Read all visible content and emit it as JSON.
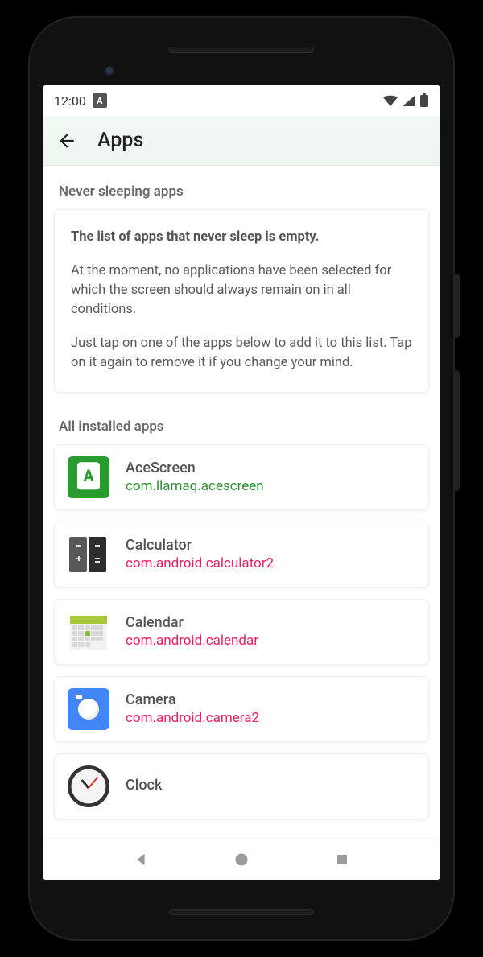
{
  "status": {
    "time": "12:00"
  },
  "header": {
    "title": "Apps"
  },
  "sections": {
    "never_sleeping_label": "Never sleeping apps",
    "all_installed_label": "All installed apps"
  },
  "info": {
    "title": "The list of apps that never sleep is empty.",
    "line1": "At the moment, no applications have been selected for which the screen should always remain on in all conditions.",
    "line2": "Just tap on one of the apps below to add it to this list. Tap on it again to remove it if you change your mind."
  },
  "apps": [
    {
      "name": "AceScreen",
      "package": "com.llamaq.acescreen",
      "pkg_style": "green"
    },
    {
      "name": "Calculator",
      "package": "com.android.calculator2",
      "pkg_style": "pink"
    },
    {
      "name": "Calendar",
      "package": "com.android.calendar",
      "pkg_style": "pink"
    },
    {
      "name": "Camera",
      "package": "com.android.camera2",
      "pkg_style": "pink"
    },
    {
      "name": "Clock",
      "package": "",
      "pkg_style": "pink"
    }
  ]
}
